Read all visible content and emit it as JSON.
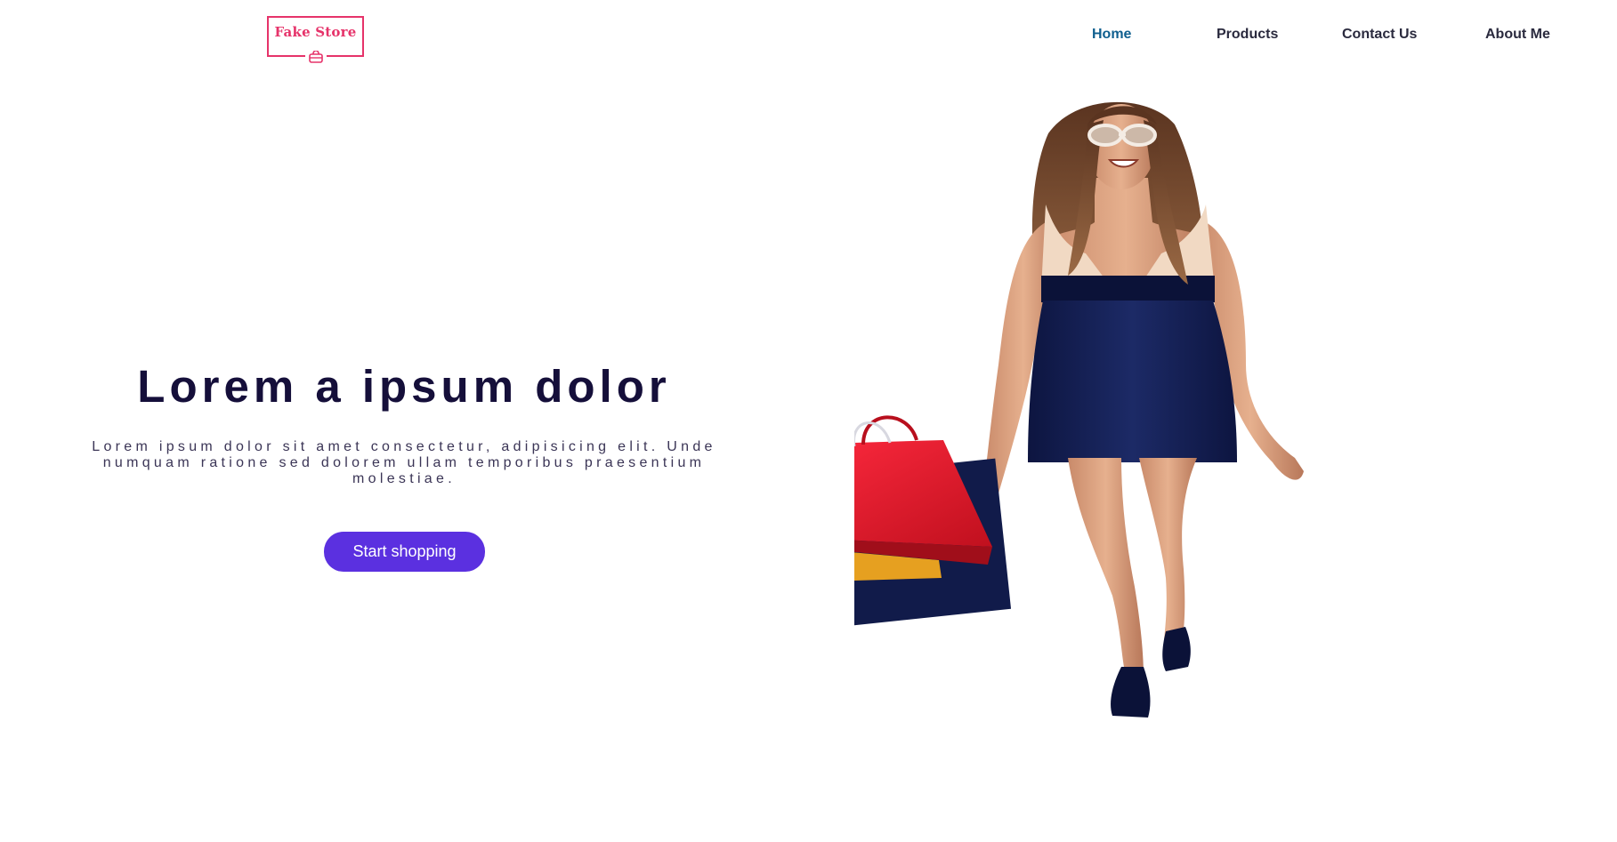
{
  "brand": {
    "logo_text": "Fake Store",
    "logo_icon": "shopping-bag-icon",
    "color": "#e6336a"
  },
  "nav": {
    "items": [
      {
        "label": "Home",
        "active": true
      },
      {
        "label": "Products",
        "active": false
      },
      {
        "label": "Contact Us",
        "active": false
      },
      {
        "label": "About Me",
        "active": false
      }
    ],
    "active_color": "#0f5f8f",
    "text_color": "#2a2a3e"
  },
  "hero": {
    "title": "Lorem a ipsum dolor",
    "subtitle": "Lorem ipsum dolor sit amet consectetur, adipisicing elit. Unde numquam ratione sed dolorem ullam temporibus praesentium molestiae.",
    "cta_label": "Start shopping",
    "cta_color": "#5b30e0",
    "title_color": "#150f3a"
  }
}
